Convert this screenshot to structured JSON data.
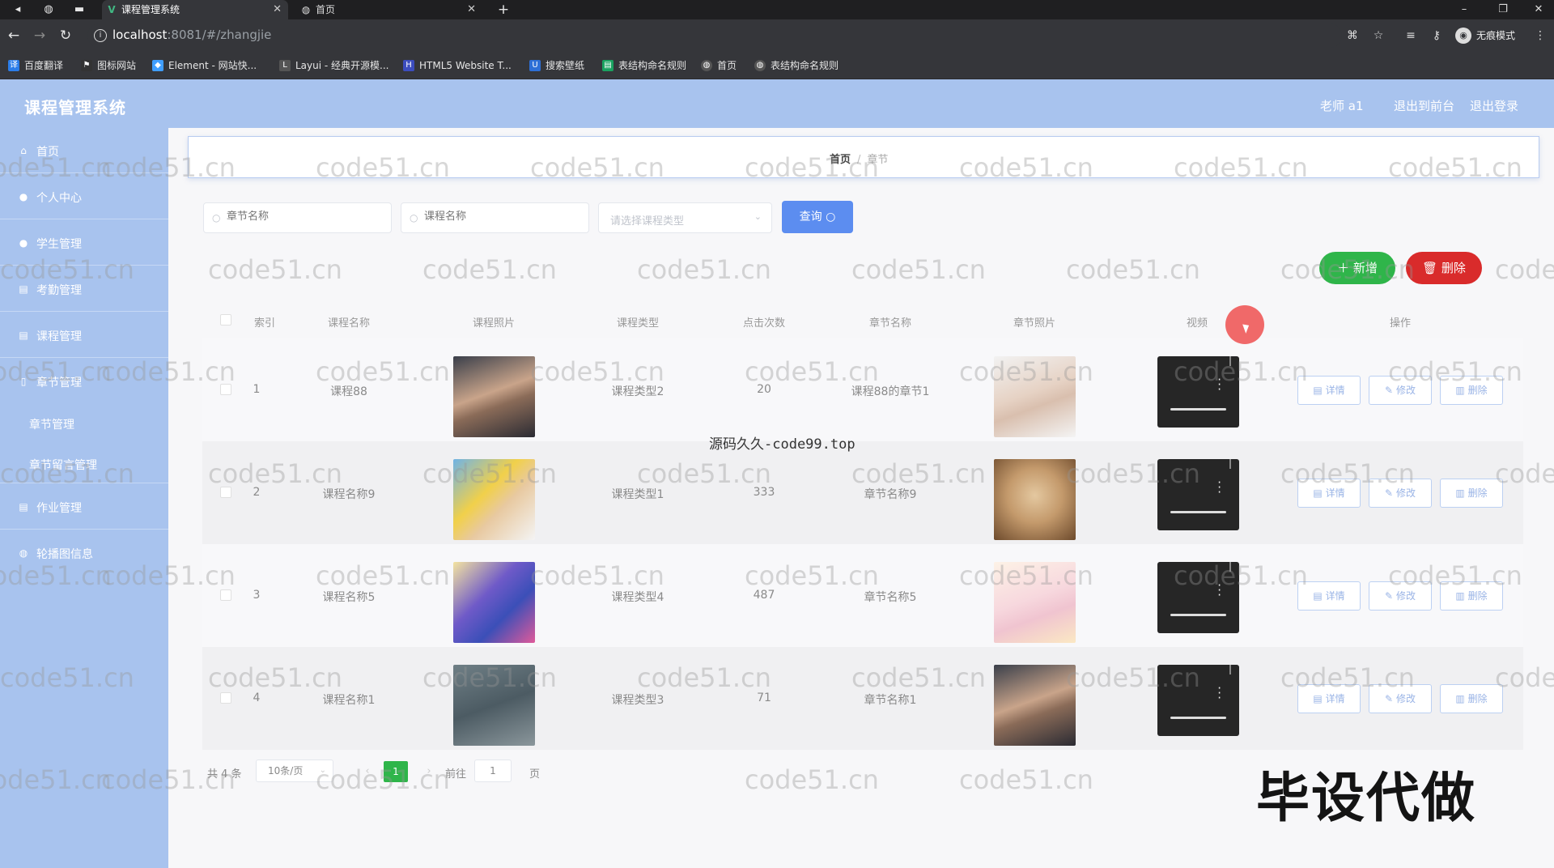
{
  "browser": {
    "tabs": [
      {
        "title": "课程管理系统",
        "active": true,
        "icon": "vue-icon"
      },
      {
        "title": "首页",
        "active": false,
        "icon": "globe-icon"
      }
    ],
    "url_host": "localhost",
    "url_rest": ":8081/#/zhangjie",
    "profile_label": "无痕模式",
    "bookmarks": [
      {
        "label": "百度翻译",
        "color": "#2b7de9"
      },
      {
        "label": "图标网站",
        "color": "#333333"
      },
      {
        "label": "Element - 网站快...",
        "color": "#409eff"
      },
      {
        "label": "Layui - 经典开源模...",
        "color": "#555555"
      },
      {
        "label": "HTML5 Website T...",
        "color": "#3c4dbe"
      },
      {
        "label": "搜索壁纸",
        "color": "#2d6fd6"
      },
      {
        "label": "表结构命名规则",
        "color": "#1aa260"
      },
      {
        "label": "首页",
        "color": "#555555"
      },
      {
        "label": "表结构命名规则",
        "color": "#555555"
      }
    ]
  },
  "header": {
    "title": "课程管理系统",
    "user": "老师 a1",
    "back_front": "退出到前台",
    "logout": "退出登录"
  },
  "sidebar": {
    "items": [
      {
        "label": "首页",
        "icon": "home-icon"
      },
      {
        "label": "个人中心",
        "icon": "user-icon"
      },
      {
        "label": "学生管理",
        "icon": "user-icon"
      },
      {
        "label": "考勤管理",
        "icon": "list-icon"
      },
      {
        "label": "课程管理",
        "icon": "list-icon"
      },
      {
        "label": "章节管理",
        "icon": "doc-icon"
      }
    ],
    "sub_items": [
      {
        "label": "章节管理"
      },
      {
        "label": "章节留言管理"
      }
    ],
    "bottom_items": [
      {
        "label": "作业管理",
        "icon": "list-icon"
      },
      {
        "label": "轮播图信息",
        "icon": "globe-icon"
      }
    ]
  },
  "breadcrumb": {
    "home": "首页",
    "current": "章节"
  },
  "search": {
    "chapter_placeholder": "章节名称",
    "course_placeholder": "课程名称",
    "type_placeholder": "请选择课程类型",
    "query_label": "查询"
  },
  "actions": {
    "add_label": "新增",
    "delete_label": "删除"
  },
  "table": {
    "headers": [
      "索引",
      "课程名称",
      "课程照片",
      "课程类型",
      "点击次数",
      "章节名称",
      "章节照片",
      "视频",
      "操作"
    ],
    "rows": [
      {
        "index": "1",
        "course": "课程88",
        "type": "课程类型2",
        "clicks": "20",
        "chapter": "课程88的章节1"
      },
      {
        "index": "2",
        "course": "课程名称9",
        "type": "课程类型1",
        "clicks": "333",
        "chapter": "章节名称9"
      },
      {
        "index": "3",
        "course": "课程名称5",
        "type": "课程类型4",
        "clicks": "487",
        "chapter": "章节名称5"
      },
      {
        "index": "4",
        "course": "课程名称1",
        "type": "课程类型3",
        "clicks": "71",
        "chapter": "章节名称1"
      }
    ],
    "op_detail": "详情",
    "op_edit": "修改",
    "op_delete": "删除"
  },
  "pagination": {
    "total": "共 4 条",
    "page_size": "10条/页",
    "current_page": "1",
    "goto_prefix": "前往",
    "goto_value": "1",
    "goto_suffix": "页"
  },
  "overlays": {
    "watermark": "code51.cn",
    "mid_text": "源码久久-code99.top",
    "big_text": "毕设代做"
  },
  "colors": {
    "header_bg": "#a8c3ee",
    "primary": "#5c8df0",
    "success": "#2fb54a",
    "danger": "#d92b2b"
  }
}
